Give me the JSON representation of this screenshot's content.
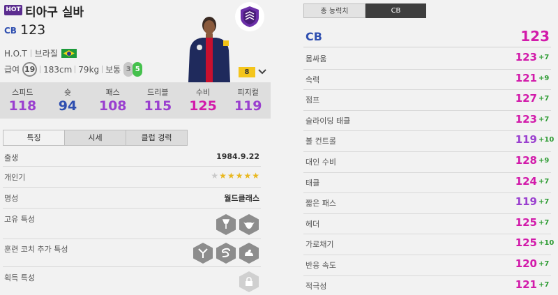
{
  "player": {
    "season_badge": "HOT",
    "name": "티아구 실바",
    "position": "CB",
    "ovr": "123",
    "season": "H.O.T",
    "nationality": "브라질",
    "pay_label": "급여",
    "pay": "19",
    "height": "183cm",
    "weight": "79kg",
    "body_type": "보통",
    "weak_foot": "3",
    "skill_moves": "5",
    "level": "8"
  },
  "stats": [
    {
      "label": "스피드",
      "value": "118",
      "color": "#9a3fcf"
    },
    {
      "label": "슛",
      "value": "94",
      "color": "#2f4fb0"
    },
    {
      "label": "패스",
      "value": "108",
      "color": "#9a3fcf"
    },
    {
      "label": "드리블",
      "value": "115",
      "color": "#9a3fcf"
    },
    {
      "label": "수비",
      "value": "125",
      "color": "#d21aaa"
    },
    {
      "label": "피지컬",
      "value": "119",
      "color": "#9a3fcf"
    }
  ],
  "tabs": [
    {
      "label": "특징"
    },
    {
      "label": "시세"
    },
    {
      "label": "클럽 경력"
    }
  ],
  "info": {
    "birth_label": "출생",
    "birth": "1984.9.22",
    "popularity_label": "개인기",
    "reputation_label": "명성",
    "reputation": "월드클래스",
    "traits_label": "고유 특성",
    "coach_traits_label": "훈련 코치 추가 특성",
    "acquired_traits_label": "획득 특성"
  },
  "right_tabs": [
    {
      "label": "총 능력치"
    },
    {
      "label": "CB"
    }
  ],
  "attributes_header": {
    "label": "CB",
    "value": "123"
  },
  "attributes": [
    {
      "label": "몸싸움",
      "value": "123",
      "bonus": "+7",
      "tone": "pink"
    },
    {
      "label": "속력",
      "value": "121",
      "bonus": "+9",
      "tone": "pink"
    },
    {
      "label": "점프",
      "value": "127",
      "bonus": "+7",
      "tone": "pink"
    },
    {
      "label": "슬라이딩 태클",
      "value": "123",
      "bonus": "+7",
      "tone": "pink"
    },
    {
      "label": "볼 컨트롤",
      "value": "119",
      "bonus": "+10",
      "tone": "purple"
    },
    {
      "label": "대인 수비",
      "value": "128",
      "bonus": "+9",
      "tone": "pink"
    },
    {
      "label": "태클",
      "value": "124",
      "bonus": "+7",
      "tone": "pink"
    },
    {
      "label": "짧은 패스",
      "value": "119",
      "bonus": "+7",
      "tone": "purple"
    },
    {
      "label": "헤더",
      "value": "125",
      "bonus": "+7",
      "tone": "pink"
    },
    {
      "label": "가로채기",
      "value": "125",
      "bonus": "+10",
      "tone": "pink"
    },
    {
      "label": "반응 속도",
      "value": "120",
      "bonus": "+7",
      "tone": "pink"
    },
    {
      "label": "적극성",
      "value": "121",
      "bonus": "+7",
      "tone": "pink"
    }
  ],
  "colors": {
    "accent_pink": "#d21aaa",
    "accent_purple": "#9a3fcf",
    "accent_blue": "#2f4fb0",
    "bonus_green": "#2e9c34"
  }
}
